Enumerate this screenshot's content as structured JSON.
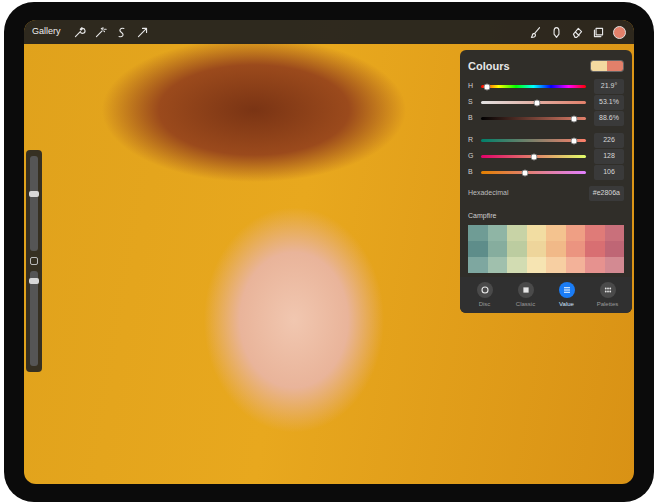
{
  "toolbar": {
    "gallery": "Gallery",
    "current_color": {
      "color": "#e2806a"
    }
  },
  "sidebar": {
    "size": {
      "level": 0.6
    },
    "opacity": {
      "level": 0.9
    }
  },
  "colours": {
    "title": "Colours",
    "primary": {
      "color": "#f3d9a0"
    },
    "secondary": {
      "color": "#e2806a"
    },
    "hsb": [
      {
        "label": "H",
        "level": 0.06,
        "reading": "21.9°"
      },
      {
        "label": "S",
        "level": 0.531,
        "reading": "53.1%"
      },
      {
        "label": "B",
        "level": 0.886,
        "reading": "88.6%"
      }
    ],
    "rgb": [
      {
        "label": "R",
        "level": 0.886,
        "reading": "226"
      },
      {
        "label": "G",
        "level": 0.502,
        "reading": "128"
      },
      {
        "label": "B",
        "level": 0.416,
        "reading": "106"
      }
    ],
    "hex": {
      "label": "Hexadecimal",
      "value": "#e2806a"
    },
    "palette": {
      "name": "Campfire",
      "swatches": [
        {
          "color": "#6f9c95"
        },
        {
          "color": "#8fb5a5"
        },
        {
          "color": "#c8d3a6"
        },
        {
          "color": "#f2dda2"
        },
        {
          "color": "#f4c38f"
        },
        {
          "color": "#ef9f84"
        },
        {
          "color": "#df7b78"
        },
        {
          "color": "#c9707b"
        },
        {
          "color": "#5e8d8a"
        },
        {
          "color": "#86ad9e"
        },
        {
          "color": "#bccca0"
        },
        {
          "color": "#eed59b"
        },
        {
          "color": "#f1b988"
        },
        {
          "color": "#eb9480"
        },
        {
          "color": "#d86f72"
        },
        {
          "color": "#bf6675"
        },
        {
          "color": "#7ea7a0"
        },
        {
          "color": "#a0c0ad"
        },
        {
          "color": "#d2dcb2"
        },
        {
          "color": "#f6e4b2"
        },
        {
          "color": "#f7cfa2"
        },
        {
          "color": "#f3b299"
        },
        {
          "color": "#e6928f"
        },
        {
          "color": "#d38a92"
        }
      ]
    },
    "tabs": [
      {
        "label": "Disc",
        "selected": false
      },
      {
        "label": "Classic",
        "selected": false
      },
      {
        "label": "Value",
        "selected": true
      },
      {
        "label": "Palettes",
        "selected": false
      }
    ]
  }
}
